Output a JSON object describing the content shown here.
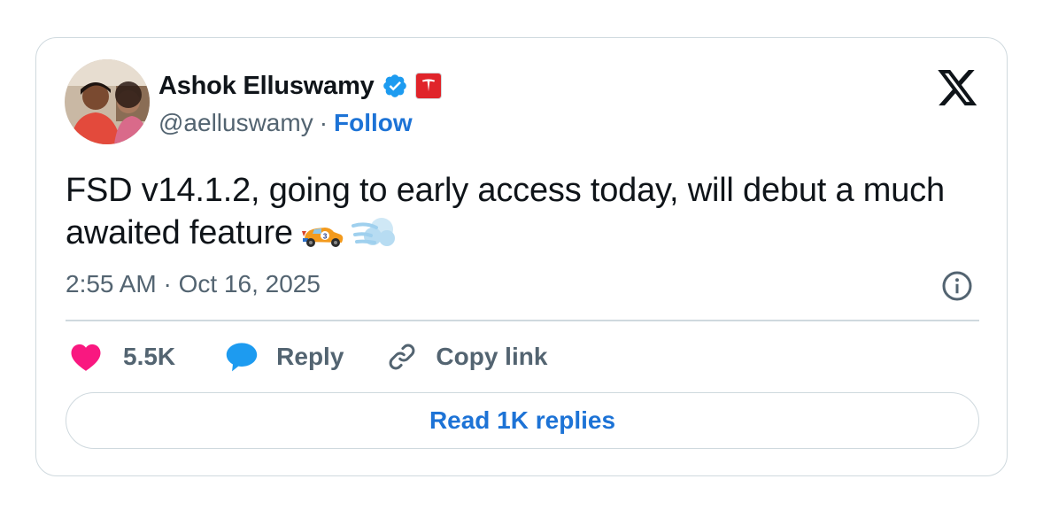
{
  "author": {
    "name": "Ashok Elluswamy",
    "handle": "@aelluswamy",
    "separator": "·",
    "follow_label": "Follow",
    "verified_badge_icon": "verified-check-icon",
    "affiliate_badge_icon": "tesla-logo-icon",
    "avatar_icon": "avatar-photo"
  },
  "platform": {
    "logo_icon": "x-logo-icon"
  },
  "tweet": {
    "text": "FSD v14.1.2, going to early access today, will debut a much awaited feature",
    "emojis": [
      "racing-car-emoji",
      "dash-symbol-emoji"
    ],
    "timestamp": "2:55 AM · Oct 16, 2025",
    "info_icon": "info-icon"
  },
  "actions": {
    "like_count": "5.5K",
    "reply_label": "Reply",
    "copy_link_label": "Copy link"
  },
  "read_replies_label": "Read 1K replies",
  "colors": {
    "text": "#0f1419",
    "secondary": "#536471",
    "accent_blue": "#1d73d6",
    "verified_blue": "#1d9bf0",
    "heart_pink": "#f91880",
    "border": "#cfd9de"
  }
}
